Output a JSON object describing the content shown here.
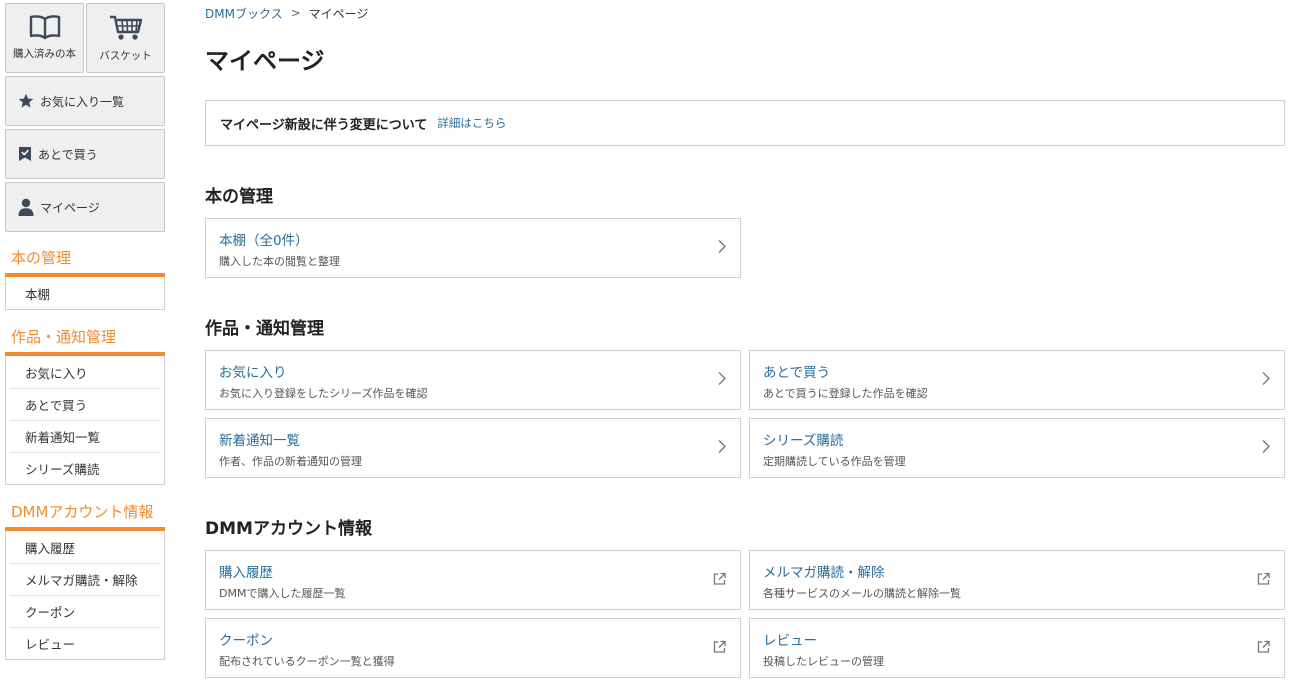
{
  "sidebar": {
    "top_tiles": [
      {
        "label": "購入済みの本",
        "icon": "book-icon"
      },
      {
        "label": "バスケット",
        "icon": "cart-icon"
      }
    ],
    "buttons": [
      {
        "label": "お気に入り一覧",
        "icon": "star-icon"
      },
      {
        "label": "あとで買う",
        "icon": "bookmark-check-icon"
      },
      {
        "label": "マイページ",
        "icon": "user-icon"
      }
    ],
    "sections": [
      {
        "title": "本の管理",
        "items": [
          "本棚"
        ]
      },
      {
        "title": "作品・通知管理",
        "items": [
          "お気に入り",
          "あとで買う",
          "新着通知一覧",
          "シリーズ購読"
        ]
      },
      {
        "title": "DMMアカウント情報",
        "items": [
          "購入履歴",
          "メルマガ購読・解除",
          "クーポン",
          "レビュー"
        ]
      }
    ]
  },
  "breadcrumb": {
    "root": "DMMブックス",
    "separator": ">",
    "current": "マイページ"
  },
  "page_title": "マイページ",
  "notice": {
    "text": "マイページ新設に伴う変更について",
    "link": "詳細はこちら"
  },
  "sections": [
    {
      "title": "本の管理",
      "cards": [
        {
          "title": "本棚（全0件）",
          "desc": "購入した本の閲覧と整理",
          "icon": "chevron-right-icon"
        }
      ]
    },
    {
      "title": "作品・通知管理",
      "cards": [
        {
          "title": "お気に入り",
          "desc": "お気に入り登録をしたシリーズ作品を確認",
          "icon": "chevron-right-icon"
        },
        {
          "title": "あとで買う",
          "desc": "あとで買うに登録した作品を確認",
          "icon": "chevron-right-icon"
        },
        {
          "title": "新着通知一覧",
          "desc": "作者、作品の新着通知の管理",
          "icon": "chevron-right-icon"
        },
        {
          "title": "シリーズ購読",
          "desc": "定期購読している作品を管理",
          "icon": "chevron-right-icon"
        }
      ]
    },
    {
      "title": "DMMアカウント情報",
      "cards": [
        {
          "title": "購入履歴",
          "desc": "DMMで購入した履歴一覧",
          "icon": "external-link-icon"
        },
        {
          "title": "メルマガ購読・解除",
          "desc": "各種サービスのメールの購読と解除一覧",
          "icon": "external-link-icon"
        },
        {
          "title": "クーポン",
          "desc": "配布されているクーポン一覧と獲得",
          "icon": "external-link-icon"
        },
        {
          "title": "レビュー",
          "desc": "投稿したレビューの管理",
          "icon": "external-link-icon"
        }
      ]
    }
  ],
  "colors": {
    "accent": "#f08c2e",
    "link": "#2a6e9a",
    "icon": "#3d4a5c"
  }
}
